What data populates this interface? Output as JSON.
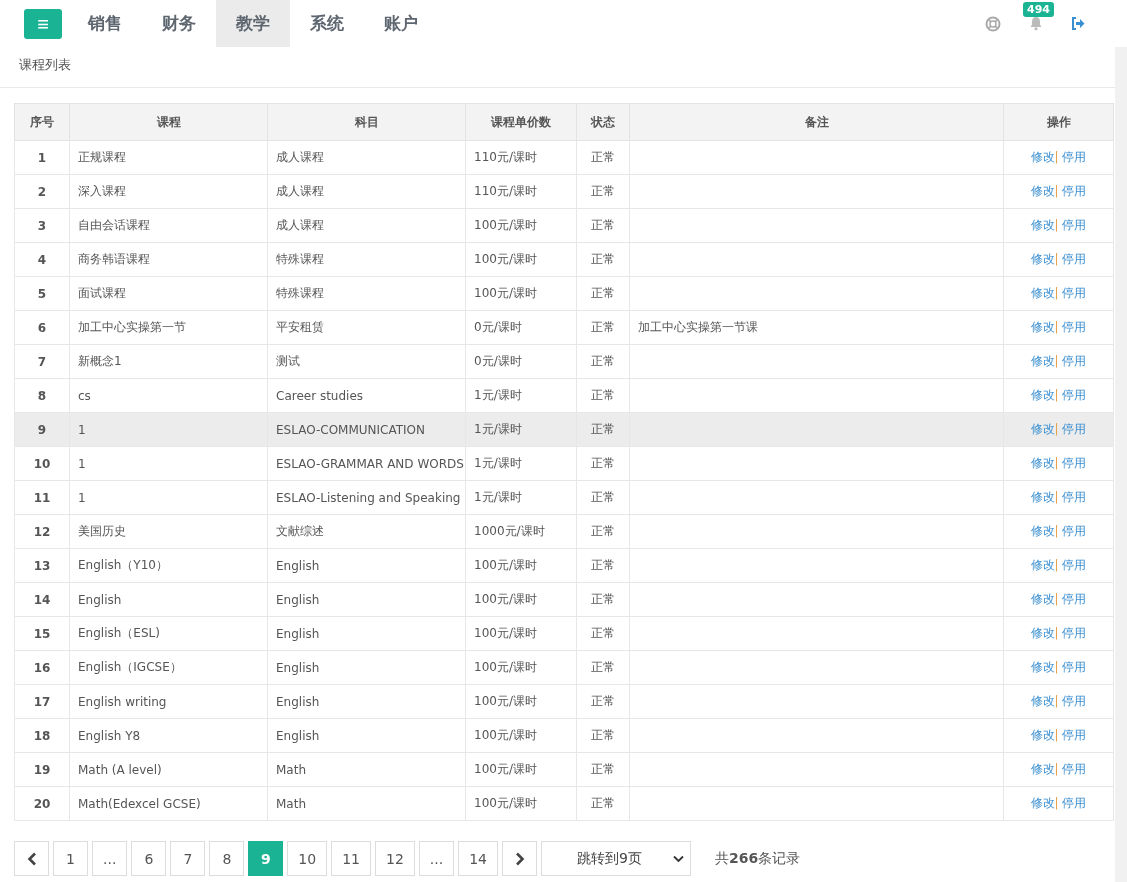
{
  "nav": {
    "menu_button": "≡",
    "items": [
      {
        "label": "销售",
        "selected": false
      },
      {
        "label": "财务",
        "selected": false
      },
      {
        "label": "教学",
        "selected": true
      },
      {
        "label": "系统",
        "selected": false
      },
      {
        "label": "账户",
        "selected": false
      }
    ],
    "notification_count": "494"
  },
  "breadcrumb": "课程列表",
  "table": {
    "columns": [
      "序号",
      "课程",
      "科目",
      "课程单价数",
      "状态",
      "备注",
      "操作"
    ],
    "rows": [
      {
        "no": "1",
        "course": "正规课程",
        "subject": "成人课程",
        "price": "110元/课时",
        "status": "正常",
        "note": "",
        "edit": "修改",
        "separator": "|",
        "disable": "停用",
        "highlighted": false
      },
      {
        "no": "2",
        "course": "深入课程",
        "subject": "成人课程",
        "price": "110元/课时",
        "status": "正常",
        "note": "",
        "edit": "修改",
        "separator": "|",
        "disable": "停用",
        "highlighted": false
      },
      {
        "no": "3",
        "course": "自由会话课程",
        "subject": "成人课程",
        "price": "100元/课时",
        "status": "正常",
        "note": "",
        "edit": "修改",
        "separator": "|",
        "disable": "停用",
        "highlighted": false
      },
      {
        "no": "4",
        "course": "商务韩语课程",
        "subject": "特殊课程",
        "price": "100元/课时",
        "status": "正常",
        "note": "",
        "edit": "修改",
        "separator": "|",
        "disable": "停用",
        "highlighted": false
      },
      {
        "no": "5",
        "course": "面试课程",
        "subject": "特殊课程",
        "price": "100元/课时",
        "status": "正常",
        "note": "",
        "edit": "修改",
        "separator": "|",
        "disable": "停用",
        "highlighted": false
      },
      {
        "no": "6",
        "course": "加工中心实操第一节",
        "subject": "平安租赁",
        "price": "0元/课时",
        "status": "正常",
        "note": "加工中心实操第一节课",
        "edit": "修改",
        "separator": "|",
        "disable": "停用",
        "highlighted": false
      },
      {
        "no": "7",
        "course": "新概念1",
        "subject": "测试",
        "price": "0元/课时",
        "status": "正常",
        "note": "",
        "edit": "修改",
        "separator": "|",
        "disable": "停用",
        "highlighted": false
      },
      {
        "no": "8",
        "course": "cs",
        "subject": "Career studies",
        "price": "1元/课时",
        "status": "正常",
        "note": "",
        "edit": "修改",
        "separator": "|",
        "disable": "停用",
        "highlighted": false
      },
      {
        "no": "9",
        "course": "1",
        "subject": "ESLAO-COMMUNICATION",
        "price": "1元/课时",
        "status": "正常",
        "note": "",
        "edit": "修改",
        "separator": "|",
        "disable": "停用",
        "highlighted": true
      },
      {
        "no": "10",
        "course": "1",
        "subject": "ESLAO-GRAMMAR AND WORDS",
        "price": "1元/课时",
        "status": "正常",
        "note": "",
        "edit": "修改",
        "separator": "|",
        "disable": "停用",
        "highlighted": false
      },
      {
        "no": "11",
        "course": "1",
        "subject": "ESLAO-Listening and Speaking",
        "price": "1元/课时",
        "status": "正常",
        "note": "",
        "edit": "修改",
        "separator": "|",
        "disable": "停用",
        "highlighted": false
      },
      {
        "no": "12",
        "course": "美国历史",
        "subject": "文献综述",
        "price": "1000元/课时",
        "status": "正常",
        "note": "",
        "edit": "修改",
        "separator": "|",
        "disable": "停用",
        "highlighted": false
      },
      {
        "no": "13",
        "course": "English（Y10）",
        "subject": "English",
        "price": "100元/课时",
        "status": "正常",
        "note": "",
        "edit": "修改",
        "separator": "|",
        "disable": "停用",
        "highlighted": false
      },
      {
        "no": "14",
        "course": "English",
        "subject": "English",
        "price": "100元/课时",
        "status": "正常",
        "note": "",
        "edit": "修改",
        "separator": "|",
        "disable": "停用",
        "highlighted": false
      },
      {
        "no": "15",
        "course": "English（ESL)",
        "subject": "English",
        "price": "100元/课时",
        "status": "正常",
        "note": "",
        "edit": "修改",
        "separator": "|",
        "disable": "停用",
        "highlighted": false
      },
      {
        "no": "16",
        "course": "English（IGCSE）",
        "subject": "English",
        "price": "100元/课时",
        "status": "正常",
        "note": "",
        "edit": "修改",
        "separator": "|",
        "disable": "停用",
        "highlighted": false
      },
      {
        "no": "17",
        "course": "English writing",
        "subject": "English",
        "price": "100元/课时",
        "status": "正常",
        "note": "",
        "edit": "修改",
        "separator": "|",
        "disable": "停用",
        "highlighted": false
      },
      {
        "no": "18",
        "course": "English Y8",
        "subject": "English",
        "price": "100元/课时",
        "status": "正常",
        "note": "",
        "edit": "修改",
        "separator": "|",
        "disable": "停用",
        "highlighted": false
      },
      {
        "no": "19",
        "course": "Math (A level)",
        "subject": "Math",
        "price": "100元/课时",
        "status": "正常",
        "note": "",
        "edit": "修改",
        "separator": "|",
        "disable": "停用",
        "highlighted": false
      },
      {
        "no": "20",
        "course": "Math(Edexcel GCSE)",
        "subject": "Math",
        "price": "100元/课时",
        "status": "正常",
        "note": "",
        "edit": "修改",
        "separator": "|",
        "disable": "停用",
        "highlighted": false
      }
    ]
  },
  "pagination": {
    "pages": [
      {
        "label": "1",
        "selected": false
      },
      {
        "label": "...",
        "selected": false
      },
      {
        "label": "6",
        "selected": false
      },
      {
        "label": "7",
        "selected": false
      },
      {
        "label": "8",
        "selected": false
      },
      {
        "label": "9",
        "selected": true
      },
      {
        "label": "10",
        "selected": false
      },
      {
        "label": "11",
        "selected": false
      },
      {
        "label": "12",
        "selected": false
      },
      {
        "label": "...",
        "selected": false
      },
      {
        "label": "14",
        "selected": false
      }
    ],
    "jump_select": "跳转到9页",
    "total": "共**266**条记录"
  }
}
